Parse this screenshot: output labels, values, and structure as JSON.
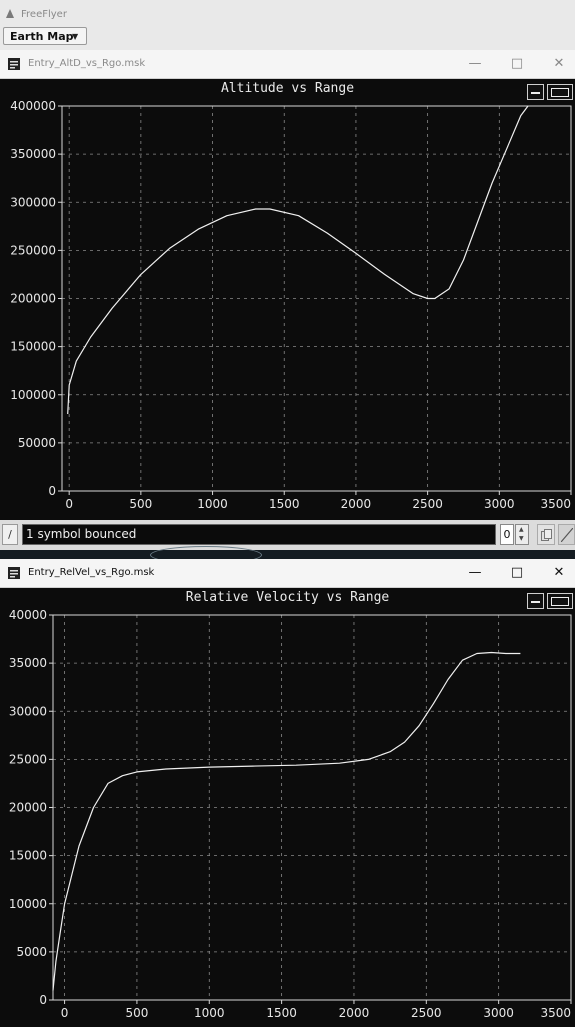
{
  "app": {
    "title": "FreeFlyer",
    "dropdown": {
      "label": "Earth Map",
      "arrow_icon": "triangle-down-icon"
    }
  },
  "windows": [
    {
      "title": "Entry_AltD_vs_Rgo.msk",
      "title_color": "#8a8a8a",
      "plot_title": "Altitude vs Range",
      "controls": [
        "minimize",
        "maximize",
        "close"
      ]
    },
    {
      "title": "Entry_RelVel_vs_Rgo.msk",
      "title_color": "#111111",
      "plot_title": "Relative Velocity vs Range",
      "controls": [
        "minimize",
        "maximize",
        "close"
      ]
    }
  ],
  "command_bar": {
    "button_label": "/",
    "text": "1 symbol bounced",
    "counter": "0"
  },
  "icons": {
    "minimize": "—",
    "maximize": "□",
    "close": "✕"
  },
  "colors": {
    "plot_background": "#0c0c0c",
    "curve": "#f0f0f0",
    "grid": "#8a8a8a"
  },
  "chart_data": [
    {
      "type": "line",
      "title": "Altitude vs Range",
      "xlabel": "",
      "ylabel": "",
      "xlim": [
        -50,
        3500
      ],
      "ylim": [
        0,
        400000
      ],
      "xticks": [
        0,
        500,
        1000,
        1500,
        2000,
        2500,
        3000,
        3500
      ],
      "yticks": [
        0,
        50000,
        100000,
        150000,
        200000,
        250000,
        300000,
        350000,
        400000
      ],
      "grid": true,
      "x": [
        -10,
        0,
        50,
        150,
        300,
        500,
        700,
        900,
        1100,
        1300,
        1400,
        1600,
        1800,
        2000,
        2200,
        2400,
        2500,
        2550,
        2650,
        2750,
        2850,
        2950,
        3050,
        3150,
        3200
      ],
      "y": [
        80000,
        110000,
        135000,
        160000,
        190000,
        225000,
        252000,
        272000,
        286000,
        293000,
        293000,
        286000,
        268000,
        247000,
        225000,
        205000,
        200000,
        200000,
        210000,
        240000,
        280000,
        320000,
        355000,
        390000,
        402000
      ]
    },
    {
      "type": "line",
      "title": "Relative Velocity vs Range",
      "xlabel": "",
      "ylabel": "",
      "xlim": [
        -80,
        3500
      ],
      "ylim": [
        0,
        40000
      ],
      "xticks": [
        0,
        500,
        1000,
        1500,
        2000,
        2500,
        3000,
        3500
      ],
      "yticks": [
        0,
        5000,
        10000,
        15000,
        20000,
        25000,
        30000,
        35000,
        40000
      ],
      "grid": true,
      "x": [
        -80,
        -60,
        -30,
        0,
        50,
        100,
        200,
        300,
        400,
        500,
        700,
        1000,
        1300,
        1600,
        1900,
        2100,
        2250,
        2350,
        2450,
        2550,
        2650,
        2750,
        2850,
        2950,
        3050,
        3150
      ],
      "y": [
        1000,
        4000,
        7000,
        10000,
        13000,
        16000,
        20000,
        22500,
        23300,
        23700,
        24000,
        24200,
        24300,
        24400,
        24600,
        25000,
        25800,
        26800,
        28500,
        30800,
        33300,
        35300,
        36000,
        36100,
        36000,
        36000
      ]
    }
  ]
}
